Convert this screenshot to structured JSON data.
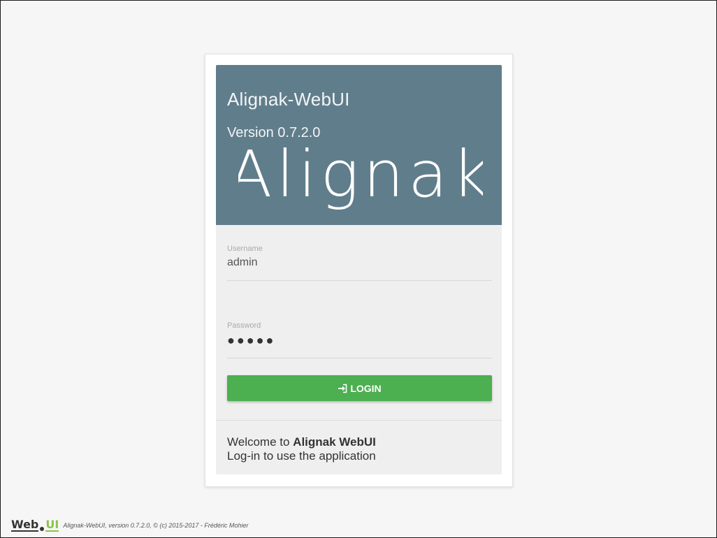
{
  "banner": {
    "title": "Alignak-WebUI",
    "version": "Version 0.7.2.0",
    "logo_text": "Alignak"
  },
  "form": {
    "username_label": "Username",
    "username_value": "admin",
    "password_label": "Password",
    "password_value": "●●●●●",
    "login_label": "LOGIN",
    "login_icon": "sign-in-icon"
  },
  "welcome": {
    "prefix": "Welcome to ",
    "app_name": "Alignak WebUI",
    "line2": "Log-in to use the application"
  },
  "footer": {
    "logo_web": "Web",
    "logo_ui": "UI",
    "text": "Alignak-WebUI, version 0.7.2.0, © (c) 2015-2017 - Frédéric Mohier"
  },
  "colors": {
    "banner": "#607d8b",
    "login_button": "#4caf50",
    "ui_accent": "#8bc34a"
  }
}
